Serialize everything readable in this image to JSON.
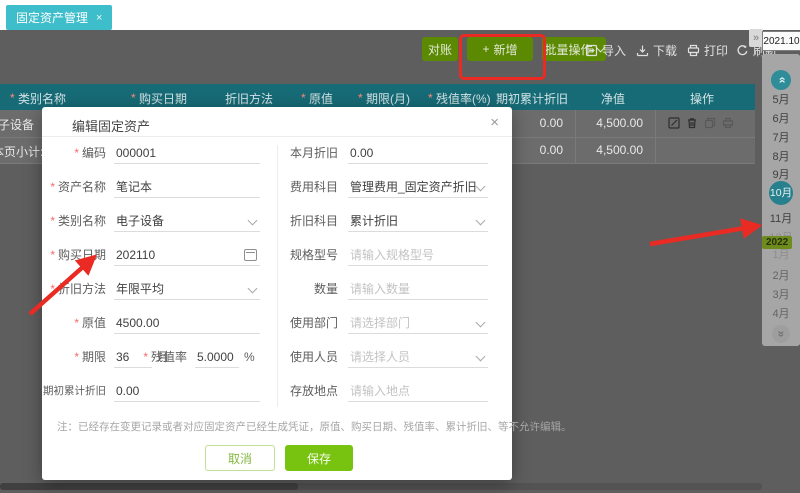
{
  "colors": {
    "tab_cyan": "#3ebdca",
    "toolbar_green": "#5b8a02",
    "header_teal": "#176b76",
    "save_green": "#77c30f",
    "annotation_red": "#ea2b23",
    "selected_month_teal": "#27808e"
  },
  "tab": {
    "label": "固定资产管理",
    "close": "×"
  },
  "toolbar": {
    "reconcile": "对账",
    "add_plus": "+",
    "add": "新增",
    "batch": "批量操作",
    "import": "导入",
    "download": "下载",
    "print": "打印",
    "refresh": "刷新"
  },
  "period": {
    "value": "2021.10",
    "expand": "»"
  },
  "table": {
    "headers": [
      {
        "label": "类别名称",
        "required": true
      },
      {
        "label": "购买日期",
        "required": true
      },
      {
        "label": "折旧方法",
        "required": false
      },
      {
        "label": "原值",
        "required": true
      },
      {
        "label": "期限(月)",
        "required": true
      },
      {
        "label": "残值率(%)",
        "required": true
      },
      {
        "label": "期初累计折旧",
        "required": false
      },
      {
        "label": "净值",
        "required": false
      },
      {
        "label": "操作",
        "required": false
      }
    ],
    "rows": [
      {
        "category": "电子设备",
        "opening_accum_dep": "0.00",
        "net_value": "4,500.00"
      },
      {
        "category": "本页小计:",
        "opening_accum_dep": "0.00",
        "net_value": "4,500.00"
      }
    ]
  },
  "month_panel": {
    "year_badge": "2022",
    "chevron_up": "»",
    "chevron_down": "»",
    "months": [
      {
        "label": "5月",
        "state": "normal"
      },
      {
        "label": "6月",
        "state": "normal"
      },
      {
        "label": "7月",
        "state": "normal"
      },
      {
        "label": "8月",
        "state": "normal"
      },
      {
        "label": "9月",
        "state": "normal"
      },
      {
        "label": "10月",
        "state": "selected"
      },
      {
        "label": "11月",
        "state": "normal"
      },
      {
        "label": "12月",
        "state": "muted"
      },
      {
        "label": "1月",
        "state": "muted"
      },
      {
        "label": "2月",
        "state": "dim"
      },
      {
        "label": "3月",
        "state": "dim"
      },
      {
        "label": "4月",
        "state": "dim"
      }
    ]
  },
  "modal": {
    "title": "编辑固定资产",
    "close": "×",
    "left": [
      {
        "label": "编码",
        "value": "000001",
        "required": true
      },
      {
        "label": "资产名称",
        "value": "笔记本",
        "required": true
      },
      {
        "label": "类别名称",
        "value": "电子设备",
        "required": true
      },
      {
        "label": "购买日期",
        "value": "202110",
        "required": true
      },
      {
        "label": "折旧方法",
        "value": "年限平均",
        "required": true
      },
      {
        "label": "原值",
        "value": "4500.00",
        "required": true
      },
      {
        "label": "期限",
        "value": "36",
        "unit": "月",
        "required": true,
        "second": {
          "label": "残值率",
          "value": "5.0000",
          "unit": "%",
          "required": true
        }
      },
      {
        "label": "期初累计折旧",
        "value": "0.00",
        "required": false
      }
    ],
    "right": [
      {
        "label": "本月折旧",
        "value": "0.00"
      },
      {
        "label": "费用科目",
        "value": "管理费用_固定资产折旧"
      },
      {
        "label": "折旧科目",
        "value": "累计折旧"
      },
      {
        "label": "规格型号",
        "placeholder": "请输入规格型号"
      },
      {
        "label": "数量",
        "placeholder": "请输入数量"
      },
      {
        "label": "使用部门",
        "placeholder": "请选择部门"
      },
      {
        "label": "使用人员",
        "placeholder": "请选择人员"
      },
      {
        "label": "存放地点",
        "placeholder": "请输入地点"
      }
    ],
    "note": "注：已经存在变更记录或者对应固定资产已经生成凭证，原值、购买日期、残值率、累计折旧、等不允许编辑。",
    "cancel": "取消",
    "save": "保存"
  }
}
